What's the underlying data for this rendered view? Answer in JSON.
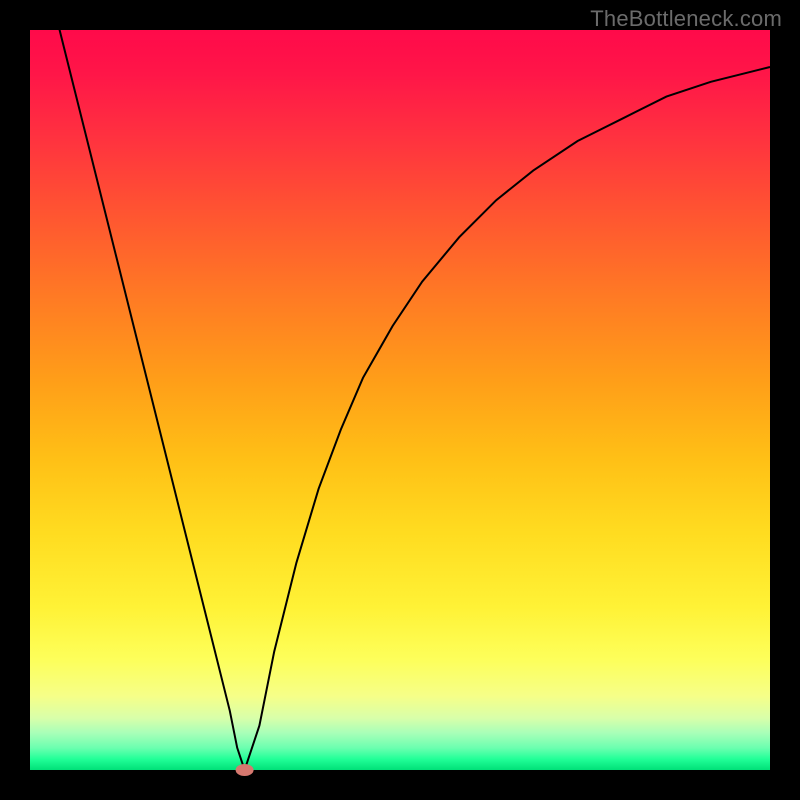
{
  "watermark": "TheBottleneck.com",
  "chart_data": {
    "type": "line",
    "title": "",
    "xlabel": "",
    "ylabel": "",
    "xlim": [
      0,
      100
    ],
    "ylim": [
      0,
      100
    ],
    "grid": false,
    "legend": false,
    "series": [
      {
        "name": "bottleneck-curve",
        "x": [
          0,
          3,
          6,
          9,
          12,
          15,
          18,
          21,
          24,
          27,
          28,
          29,
          31,
          33,
          36,
          39,
          42,
          45,
          49,
          53,
          58,
          63,
          68,
          74,
          80,
          86,
          92,
          100
        ],
        "y": [
          116,
          104,
          92,
          80,
          68,
          56,
          44,
          32,
          20,
          8,
          3,
          0,
          6,
          16,
          28,
          38,
          46,
          53,
          60,
          66,
          72,
          77,
          81,
          85,
          88,
          91,
          93,
          95
        ]
      }
    ],
    "marker": {
      "x": 29,
      "y": 0,
      "color": "#d6786f",
      "rx": 9,
      "ry": 6
    }
  },
  "colors": {
    "curve_stroke": "#000000",
    "marker_fill": "#d6786f",
    "frame": "#000000"
  }
}
